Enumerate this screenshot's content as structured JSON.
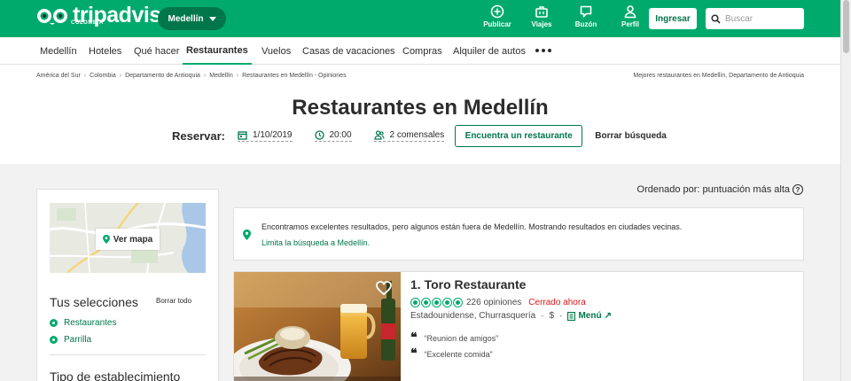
{
  "header": {
    "logo_text": "tripadvisor",
    "logo_sub": "COLOMBIA",
    "location": "Medellín",
    "icons": [
      {
        "icon": "plus-circle-icon",
        "label": "Publicar"
      },
      {
        "icon": "suitcase-icon",
        "label": "Viajes"
      },
      {
        "icon": "chat-bubble-icon",
        "label": "Buzón"
      },
      {
        "icon": "user-icon",
        "label": "Perfil"
      }
    ],
    "login_label": "Ingresar",
    "search_placeholder": "Buscar"
  },
  "nav": {
    "items": [
      "Medellín",
      "Hoteles",
      "Qué hacer",
      "Restaurantes",
      "Vuelos",
      "Casas de vacaciones",
      "Compras",
      "Alquiler de autos"
    ],
    "active": "Restaurantes"
  },
  "breadcrumb": {
    "items": [
      "América del Sur",
      "Colombia",
      "Departamento de Antioquia",
      "Medellín",
      "Restaurantes en Medellín - Opiniones"
    ],
    "right_text": "Mejores restaurantes en Medellín, Departamento de Antioquia"
  },
  "page": {
    "title": "Restaurantes en Medellín"
  },
  "reserve": {
    "label": "Reservar:",
    "date": "1/10/2019",
    "time": "20:00",
    "guests": "2 comensales",
    "find_label": "Encuentra un restaurante",
    "clear_label": "Borrar búsqueda"
  },
  "sort": {
    "label": "Ordenado por: puntuación más alta"
  },
  "sidebar": {
    "map_label": "Ver mapa",
    "selections_title": "Tus selecciones",
    "clear_all": "Borrar todo",
    "filters": [
      "Restaurantes",
      "Parrilla"
    ],
    "type_title": "Tipo de establecimiento"
  },
  "notice": {
    "text": "Encontramos excelentes resultados, pero algunos están fuera de Medellín. Mostrando resultados en ciudades vecinas.",
    "link": "Limita la búsqueda a Medellín."
  },
  "listing": {
    "name": "1. Toro Restaurante",
    "rating": 5,
    "reviews": "226 opiniones",
    "status": "Cerrado ahora",
    "cuisine": "Estadounidense, Churrasquería",
    "price": "$",
    "menu_label": "Menú",
    "quotes": [
      "“Reunion de amigos”",
      "“Excelente comida”"
    ]
  },
  "colors": {
    "brand": "#00aa6c",
    "brand_dark": "#00764b",
    "closed": "#d91919"
  }
}
